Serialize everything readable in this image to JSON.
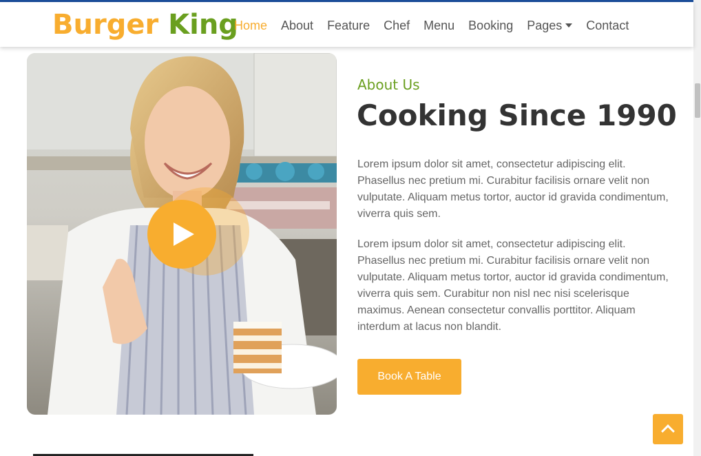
{
  "brand": {
    "word1": "Burger",
    "word2": "King"
  },
  "nav": {
    "items": [
      {
        "label": "Home",
        "active": true
      },
      {
        "label": "About"
      },
      {
        "label": "Feature"
      },
      {
        "label": "Chef"
      },
      {
        "label": "Menu"
      },
      {
        "label": "Booking"
      },
      {
        "label": "Pages",
        "dropdown": true
      },
      {
        "label": "Contact"
      }
    ]
  },
  "about": {
    "subtitle": "About Us",
    "title": "Cooking Since 1990",
    "paragraph1": "Lorem ipsum dolor sit amet, consectetur adipiscing elit. Phasellus nec pretium mi. Curabitur facilisis ornare velit non vulputate. Aliquam metus tortor, auctor id gravida condimentum, viverra quis sem.",
    "paragraph2": "Lorem ipsum dolor sit amet, consectetur adipiscing elit. Phasellus nec pretium mi. Curabitur facilisis ornare velit non vulputate. Aliquam metus tortor, auctor id gravida condimentum, viverra quis sem. Curabitur non nisl nec nisi scelerisque maximus. Aenean consectetur convallis porttitor. Aliquam interdum at lacus non blandit.",
    "button_label": "Book A Table"
  },
  "icons": {
    "play": "play-icon",
    "back_to_top": "chevron-up-icon",
    "dropdown": "caret-down-icon"
  },
  "colors": {
    "accent": "#f8ad2f",
    "brand_green": "#6a9f1f",
    "heading": "#333333",
    "text": "#666666"
  }
}
